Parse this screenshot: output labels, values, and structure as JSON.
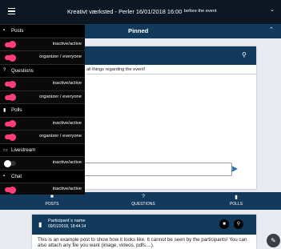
{
  "topbar": {
    "title": "Kreativt værksted - Perler  16/01/2018 16:00",
    "subtitle": "before the event"
  },
  "pinned": {
    "label": "Pinned"
  },
  "card": {
    "body_text": "all things regarding the event!"
  },
  "tabs": [
    {
      "label": "POSTS",
      "icon": "post-icon"
    },
    {
      "label": "QUESTIONS",
      "icon": "question-icon"
    },
    {
      "label": "POLLS",
      "icon": "polls-icon"
    }
  ],
  "post": {
    "author": "Participant´s name",
    "date": "09/01/2018, 18:44:14",
    "text": "This is an example post to show how it looks like. It cannot be seen by the participants! You can also attach any file you want (image, videos, pdfs....)."
  },
  "settings": {
    "sections": [
      {
        "title": "Posts",
        "icon": "post-icon",
        "rows": [
          {
            "label": "inactive/active",
            "on": true
          },
          {
            "label": "organizer / everyone",
            "on": true
          }
        ]
      },
      {
        "title": "Questions",
        "icon": "question-icon",
        "rows": [
          {
            "label": "inactive/active",
            "on": true
          },
          {
            "label": "organizer / everyone",
            "on": true
          }
        ]
      },
      {
        "title": "Polls",
        "icon": "polls-icon",
        "rows": [
          {
            "label": "inactive/active",
            "on": true
          },
          {
            "label": "organizer / everyone",
            "on": true
          }
        ]
      },
      {
        "title": "Livestream",
        "icon": "monitor-icon",
        "rows": [
          {
            "label": "inactive/active",
            "on": false
          }
        ]
      },
      {
        "title": "Chat",
        "icon": "chat-icon",
        "rows": [
          {
            "label": "inactive/active",
            "on": true
          }
        ]
      }
    ]
  },
  "colors": {
    "accent": "#ff3d79",
    "navy": "#123a5c",
    "dark": "#0c1723"
  }
}
